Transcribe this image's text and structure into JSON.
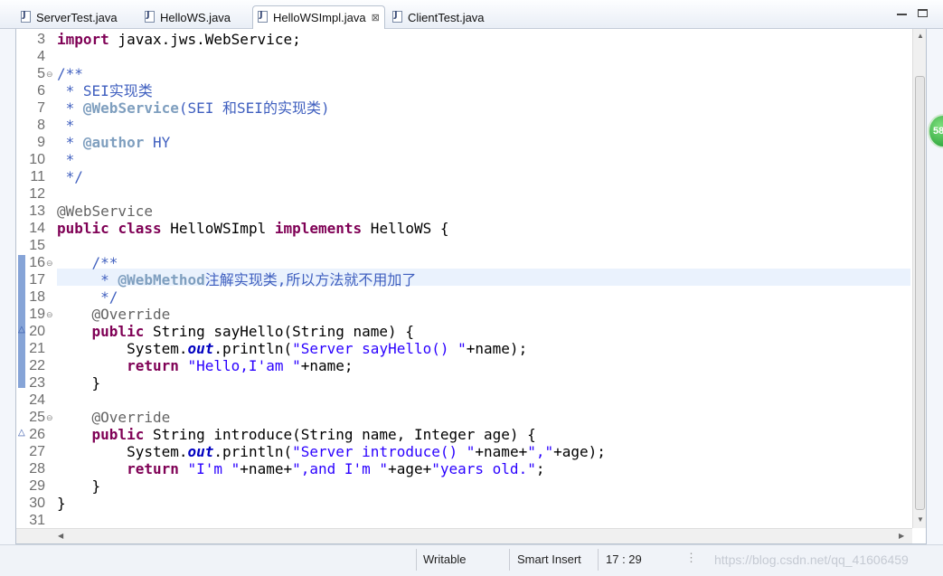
{
  "tabs": [
    {
      "label": "ServerTest.java",
      "active": false
    },
    {
      "label": "HelloWS.java",
      "active": false
    },
    {
      "label": "HelloWSImpl.java",
      "active": true
    },
    {
      "label": "ClientTest.java",
      "active": false
    }
  ],
  "active_tab_close": "⊠",
  "badge_value": "58",
  "lines": [
    {
      "num": "3",
      "html": "<span class=\"kw\">import</span> javax.jws.WebService;"
    },
    {
      "num": "4",
      "html": ""
    },
    {
      "num": "5",
      "html": "<span class=\"cm\">/**</span>",
      "fold": "⊖"
    },
    {
      "num": "6",
      "html": "<span class=\"cm\"> * SEI实现类</span>"
    },
    {
      "num": "7",
      "html": "<span class=\"cm\"> * </span><span class=\"tag\">@WebService</span><span class=\"cm\">(SEI 和SEI的实现类)</span>"
    },
    {
      "num": "8",
      "html": "<span class=\"cm\"> *</span>"
    },
    {
      "num": "9",
      "html": "<span class=\"cm\"> * </span><span class=\"tag\">@author</span><span class=\"cm\"> HY</span>"
    },
    {
      "num": "10",
      "html": "<span class=\"cm\"> *</span>"
    },
    {
      "num": "11",
      "html": "<span class=\"cm\"> */</span>"
    },
    {
      "num": "12",
      "html": ""
    },
    {
      "num": "13",
      "html": "<span class=\"ann\">@WebService</span>"
    },
    {
      "num": "14",
      "html": "<span class=\"kw\">public</span> <span class=\"kw\">class</span> HelloWSImpl <span class=\"kw\">implements</span> HelloWS {"
    },
    {
      "num": "15",
      "html": ""
    },
    {
      "num": "16",
      "html": "    <span class=\"cm\">/**</span>",
      "fold": "⊖"
    },
    {
      "num": "17",
      "html": "<span class=\"cm\">     * </span><span class=\"tag\">@WebMethod</span><span class=\"cm\">注解实现类,所以方法就不用加了</span>"
    },
    {
      "num": "18",
      "html": "<span class=\"cm\">     */</span>"
    },
    {
      "num": "19",
      "html": "    <span class=\"ann\">@Override</span>",
      "fold": "⊖"
    },
    {
      "num": "20",
      "html": "    <span class=\"kw\">public</span> String sayHello(String name) {",
      "override": "△"
    },
    {
      "num": "21",
      "html": "        System.<span class=\"fld\">out</span>.println(<span class=\"str\">\"Server sayHello() \"</span>+name);"
    },
    {
      "num": "22",
      "html": "        <span class=\"kw\">return</span> <span class=\"str\">\"Hello,I'am \"</span>+name;"
    },
    {
      "num": "23",
      "html": "    }"
    },
    {
      "num": "24",
      "html": ""
    },
    {
      "num": "25",
      "html": "    <span class=\"ann\">@Override</span>",
      "fold": "⊖"
    },
    {
      "num": "26",
      "html": "    <span class=\"kw\">public</span> String introduce(String name, Integer age) {",
      "override": "△"
    },
    {
      "num": "27",
      "html": "        System.<span class=\"fld\">out</span>.println(<span class=\"str\">\"Server introduce() \"</span>+name+<span class=\"str\">\",\"</span>+age);"
    },
    {
      "num": "28",
      "html": "        <span class=\"kw\">return</span> <span class=\"str\">\"I'm \"</span>+name+<span class=\"str\">\",and I'm \"</span>+age+<span class=\"str\">\"years old.\"</span>;"
    },
    {
      "num": "29",
      "html": "    }"
    },
    {
      "num": "30",
      "html": "}"
    },
    {
      "num": "31",
      "html": ""
    }
  ],
  "status": {
    "writable": "Writable",
    "insert_mode": "Smart Insert",
    "position": "17 : 29",
    "watermark": "https://blog.csdn.net/qq_41606459"
  }
}
